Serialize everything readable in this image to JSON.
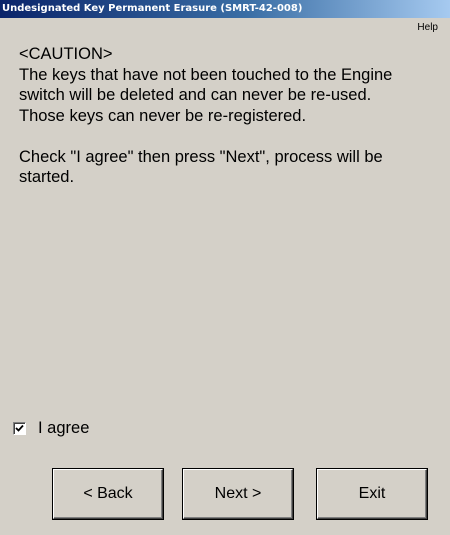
{
  "window": {
    "title": "Undesignated Key Permanent Erasure (SMRT-42-008)"
  },
  "menu": {
    "help_label": "Help"
  },
  "message": {
    "line1": "<CAUTION>",
    "line2": "The keys that have not been touched to the Engine",
    "line3": "switch will be deleted and can never be re-used.",
    "line4": "Those keys can never be re-registered.",
    "line5": "Check \"I agree\" then press \"Next\", process will be",
    "line6": "started."
  },
  "agree": {
    "label": "I agree",
    "checked": true
  },
  "buttons": {
    "back_label": "< Back",
    "next_label": "Next >",
    "exit_label": "Exit"
  }
}
